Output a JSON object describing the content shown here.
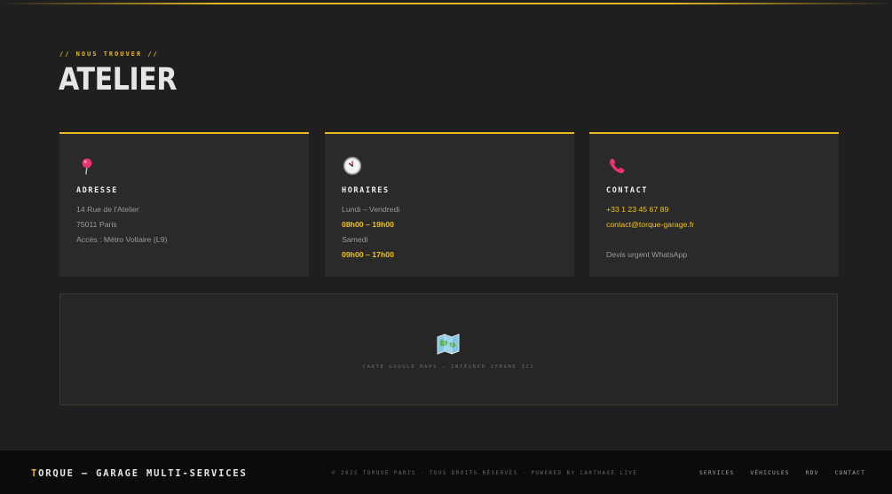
{
  "section": {
    "eyebrow": "// NOUS TROUVER //",
    "title": "ATELIER"
  },
  "cards": [
    {
      "icon": "pin-icon",
      "label": "ADRESSE",
      "lines": [
        "14 Rue de l'Atelier",
        "75011 Paris",
        "Accès : Métro Voltaire (L9)"
      ]
    },
    {
      "icon": "clock-icon",
      "label": "HORAIRES",
      "lines": [
        "Lundi – Vendredi",
        "08h00 – 19h00",
        "Samedi",
        "09h00 – 17h00"
      ]
    },
    {
      "icon": "phone-icon",
      "label": "CONTACT",
      "lines": [
        "+33 1 23 45 67 89",
        "contact@torque-garage.fr",
        "Devis urgent WhatsApp"
      ]
    }
  ],
  "map": {
    "icon": "map-icon",
    "caption": "CARTE GOOGLE MAPS — INTÉGRER IFRAME ICI"
  },
  "footer": {
    "brand_first": "T",
    "brand_rest": "ORQUE — GARAGE MULTI-SERVICES",
    "copyright": "© 2025 TORQUE PARIS · TOUS DROITS RÉSERVÉS · POWERED BY CARTHAGE LIVE",
    "nav": [
      "SERVICES",
      "VÉHICULES",
      "RDV",
      "CONTACT"
    ]
  },
  "colors": {
    "accent": "#e8b923",
    "background": "#1f1f1f",
    "card": "#2a2a2a",
    "footer": "#0b0b0b"
  }
}
